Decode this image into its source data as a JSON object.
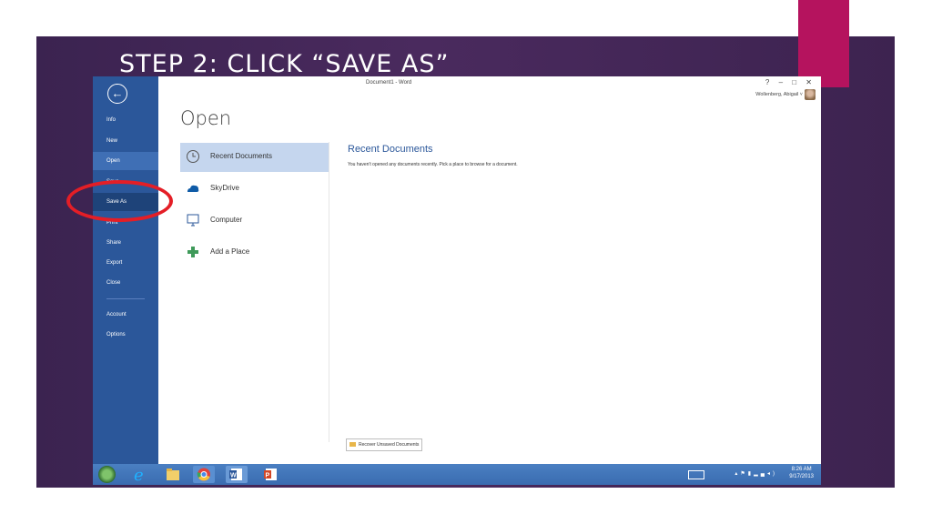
{
  "slide": {
    "title": "STEP 2: CLICK “SAVE AS”",
    "accent_color": "#b5135e",
    "background_color": "#3b2350"
  },
  "word": {
    "window_title": "Document1 - Word",
    "window_controls": "? – □ ✕",
    "user_name": "Wollenberg, Abigail ˅",
    "back_icon": "←",
    "nav": {
      "info": "Info",
      "new": "New",
      "open": "Open",
      "save": "Save",
      "save_as": "Save As",
      "print": "Print",
      "share": "Share",
      "export": "Export",
      "close": "Close",
      "account": "Account",
      "options": "Options"
    },
    "page_heading": "Open",
    "places": {
      "recent": "Recent Documents",
      "skydrive": "SkyDrive",
      "computer": "Computer",
      "add_place": "Add a Place"
    },
    "content": {
      "heading": "Recent Documents",
      "message": "You haven't opened any documents recently. Pick a place to browse for a document.",
      "recover_button": "Recover Unsaved Documents"
    },
    "brand_color": "#2b579a"
  },
  "taskbar": {
    "time": "8:26 AM",
    "date": "9/17/2013",
    "apps": [
      "ie-icon",
      "file-explorer-icon",
      "chrome-icon",
      "word-icon",
      "powerpoint-icon"
    ]
  },
  "annotation": {
    "highlight_color": "#e41e26",
    "target": "Save As"
  }
}
